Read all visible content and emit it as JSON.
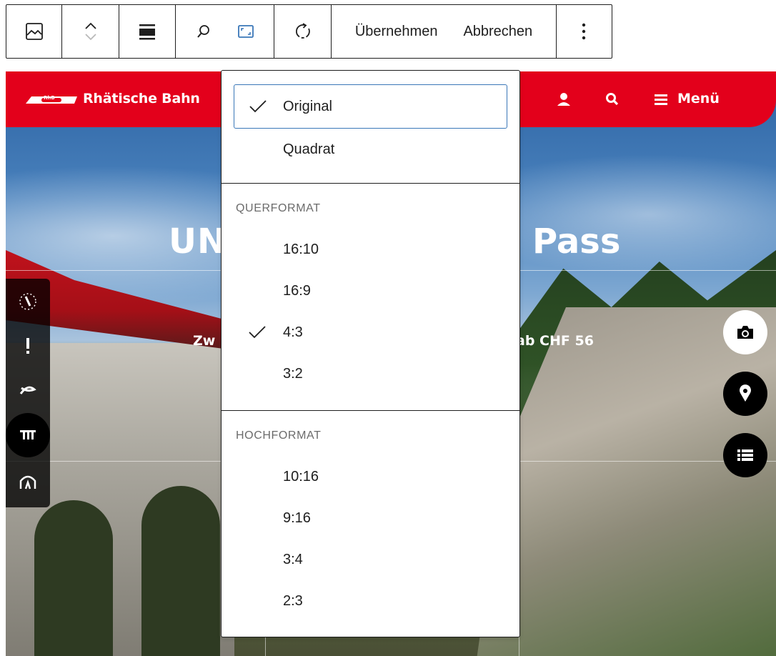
{
  "toolbar": {
    "groups": [
      {
        "name": "block-type",
        "icons": [
          "image-icon"
        ]
      },
      {
        "name": "move",
        "icons": [
          "chevron-up-icon",
          "chevron-down-icon"
        ]
      },
      {
        "name": "align",
        "icons": [
          "align-icon"
        ]
      },
      {
        "name": "crop-tools",
        "icons": [
          "zoom-icon",
          "aspect-ratio-icon"
        ]
      },
      {
        "name": "rotate",
        "icons": [
          "rotate-icon"
        ]
      }
    ],
    "apply_label": "Übernehmen",
    "cancel_label": "Abbrechen",
    "more_icon": "kebab-menu-icon",
    "colors": {
      "border": "#1e1e1e",
      "active": "#3a77b8"
    }
  },
  "site": {
    "logo_badge": "RhB",
    "logo_text": "Rhätische Bahn",
    "menu_label": "Menü",
    "brand_color": "#e3001b",
    "hero_title_left": "UN",
    "hero_title_right": "Pass",
    "hero_subtitle_left": "Zw",
    "hero_subtitle_right": "ab CHF 56",
    "header_icons": [
      "user-icon",
      "search-icon",
      "hamburger-icon"
    ],
    "side_rail_icons": [
      "clock-icon",
      "alert-icon",
      "route-icon",
      "station-icon",
      "tunnel-icon"
    ],
    "floating_buttons": [
      "camera-icon",
      "location-pin-icon",
      "list-icon"
    ]
  },
  "dropdown": {
    "top_items": [
      {
        "label": "Original",
        "checked": true
      },
      {
        "label": "Quadrat",
        "checked": false
      }
    ],
    "landscape": {
      "heading": "QUERFORMAT",
      "items": [
        {
          "label": "16:10",
          "checked": false
        },
        {
          "label": "16:9",
          "checked": false
        },
        {
          "label": "4:3",
          "checked": true
        },
        {
          "label": "3:2",
          "checked": false
        }
      ]
    },
    "portrait": {
      "heading": "HOCHFORMAT",
      "items": [
        {
          "label": "10:16",
          "checked": false
        },
        {
          "label": "9:16",
          "checked": false
        },
        {
          "label": "3:4",
          "checked": false
        },
        {
          "label": "2:3",
          "checked": false
        }
      ]
    }
  }
}
